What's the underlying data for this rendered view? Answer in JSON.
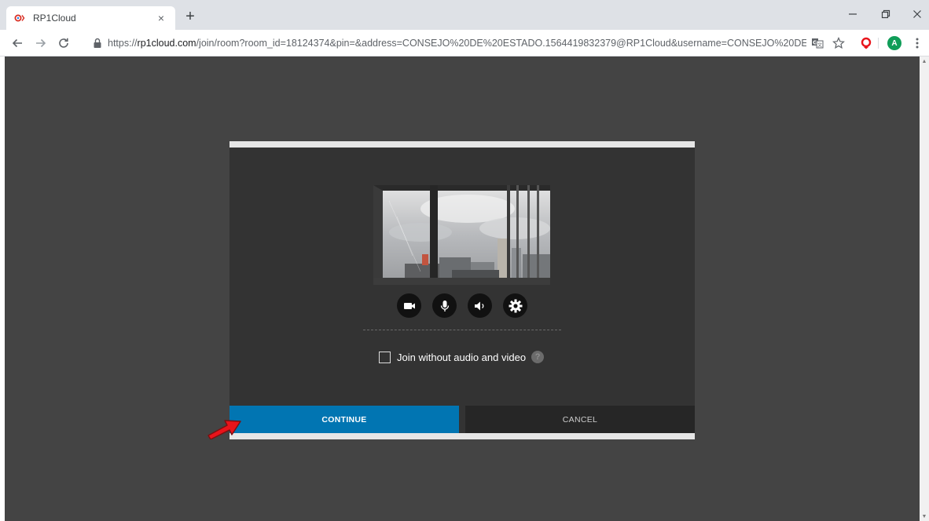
{
  "browser": {
    "tab_title": "RP1Cloud",
    "tab_close": "×",
    "new_tab": "+",
    "url_scheme": "https://",
    "url_host": "rp1cloud.com",
    "url_rest": "/join/room?room_id=18124374&pin=&address=CONSEJO%20DE%20ESTADO.1564419832379@RP1Cloud&username=CONSEJO%20DE%20EST...",
    "profile_initial": "A",
    "icons": [
      "back-icon",
      "forward-icon",
      "reload-icon",
      "lock-icon",
      "translate-icon",
      "star-icon",
      "extension-icon",
      "profile-avatar",
      "menu-icon"
    ]
  },
  "dialog": {
    "join_without_label": "Join without audio and video",
    "help_symbol": "?",
    "continue_label": "CONTINUE",
    "cancel_label": "CANCEL",
    "controls": [
      "camera-icon",
      "microphone-icon",
      "speaker-icon",
      "settings-gear-icon"
    ]
  },
  "colors": {
    "page_bg": "#444444",
    "dialog_bg": "#333333",
    "continue_bg": "#0175b2",
    "cancel_bg": "#262626",
    "arrow": "#e8141b"
  }
}
